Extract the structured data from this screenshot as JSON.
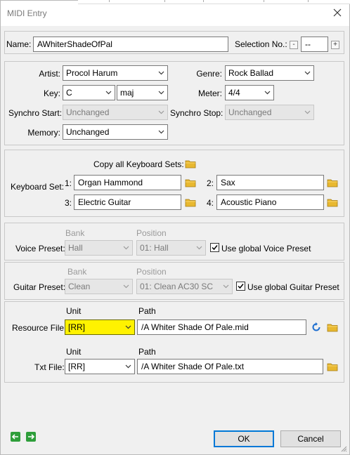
{
  "window": {
    "title": "MIDI Entry"
  },
  "name_row": {
    "name_label": "Name:",
    "name_value": "AWhiterShadeOfPal",
    "selection_label": "Selection No.:",
    "selection_minus": "-",
    "selection_value": "--",
    "selection_plus": "+"
  },
  "meta": {
    "artist_label": "Artist:",
    "artist_value": "Procol Harum",
    "genre_label": "Genre:",
    "genre_value": "Rock Ballad",
    "key_label": "Key:",
    "key_value": "C",
    "key_mode": "maj",
    "meter_label": "Meter:",
    "meter_value": "4/4",
    "synchro_start_label": "Synchro Start:",
    "synchro_start_value": "Unchanged",
    "synchro_stop_label": "Synchro Stop:",
    "synchro_stop_value": "Unchanged",
    "memory_label": "Memory:",
    "memory_value": "Unchanged"
  },
  "keyboard": {
    "copy_label": "Copy all Keyboard Sets:",
    "set_label": "Keyboard Set:",
    "sets": [
      {
        "num": "1:",
        "value": "Organ Hammond"
      },
      {
        "num": "2:",
        "value": "Sax"
      },
      {
        "num": "3:",
        "value": "Electric Guitar"
      },
      {
        "num": "4:",
        "value": "Acoustic Piano"
      }
    ]
  },
  "voice": {
    "bank_header": "Bank",
    "position_header": "Position",
    "label": "Voice Preset:",
    "bank_value": "Hall",
    "position_value": "01: Hall",
    "global_label": "Use global Voice Preset",
    "global_checked": true
  },
  "guitar": {
    "bank_header": "Bank",
    "position_header": "Position",
    "label": "Guitar Preset:",
    "bank_value": "Clean",
    "position_value": "01: Clean AC30 SC",
    "global_label": "Use global Guitar Preset",
    "global_checked": true
  },
  "resource": {
    "unit_header": "Unit",
    "path_header": "Path",
    "label": "Resource File:",
    "unit_value": "[RR]",
    "path_value": "/A Whiter Shade Of Pale.mid"
  },
  "txt": {
    "unit_header": "Unit",
    "path_header": "Path",
    "label": "Txt File:",
    "unit_value": "[RR]",
    "path_value": "/A Whiter Shade Of Pale.txt"
  },
  "buttons": {
    "ok": "OK",
    "cancel": "Cancel"
  },
  "colors": {
    "highlight": "#fff200",
    "focus_border": "#0078d7",
    "nav_green": "#2e9e3a",
    "folder_yellow": "#e8b830"
  }
}
